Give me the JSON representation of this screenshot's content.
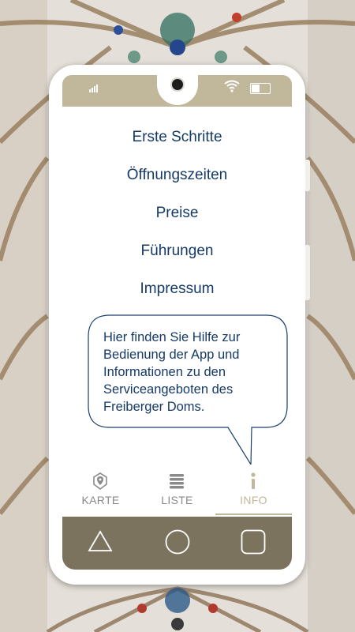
{
  "colors": {
    "accent": "#c1b79a",
    "navbar": "#7c735f",
    "text_primary": "#163a66",
    "tab_inactive": "#8a8a8a"
  },
  "menu": {
    "items": [
      {
        "label": "Erste Schritte"
      },
      {
        "label": "Öffnungszeiten"
      },
      {
        "label": "Preise"
      },
      {
        "label": "Führungen"
      },
      {
        "label": "Impressum"
      }
    ]
  },
  "bubble": {
    "lines": [
      "Hier finden Sie Hilfe zur",
      "Bedienung der App und",
      "Informationen zu den",
      "Serviceangeboten des",
      "Freiberger Doms."
    ]
  },
  "tabs": [
    {
      "label": "KARTE",
      "icon": "map-pin-icon",
      "active": false
    },
    {
      "label": "LISTE",
      "icon": "list-icon",
      "active": false
    },
    {
      "label": "INFO",
      "icon": "info-icon",
      "active": true
    }
  ],
  "system_nav": {
    "icons": [
      "back-triangle-icon",
      "home-circle-icon",
      "recents-square-icon"
    ]
  },
  "status_icons": [
    "signal-icon",
    "wifi-icon",
    "battery-icon"
  ]
}
